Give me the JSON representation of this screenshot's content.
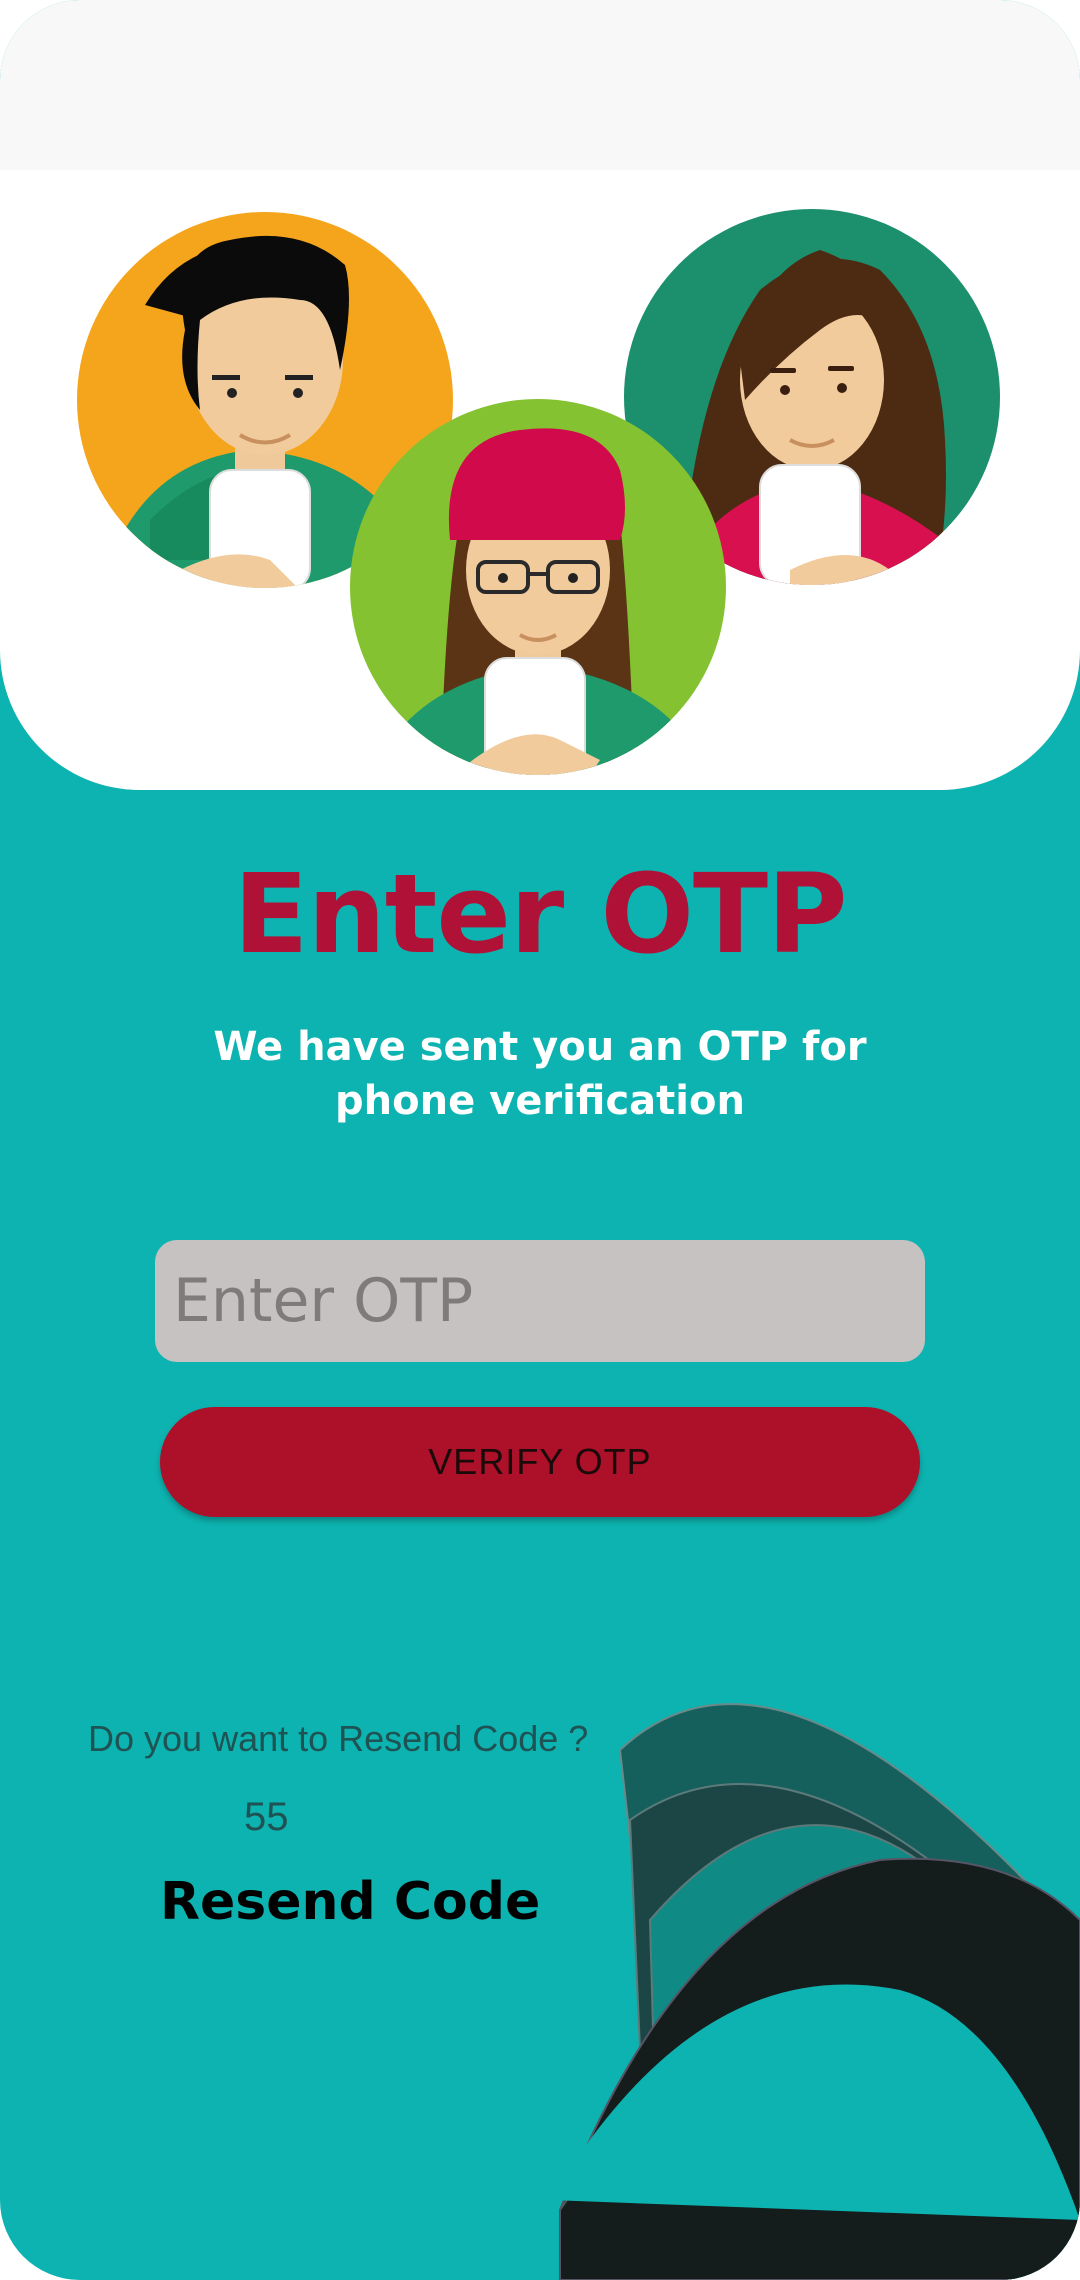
{
  "screen": {
    "title": "Enter OTP",
    "subtitle": "We have sent you an OTP for phone verification"
  },
  "otp_field": {
    "placeholder": "Enter OTP",
    "value": ""
  },
  "verify_button": {
    "label": "VERIFY OTP"
  },
  "resend": {
    "question": "Do you want to Resend Code ?",
    "countdown": "55",
    "link_label": "Resend Code"
  },
  "colors": {
    "background": "#0db3b0",
    "accent": "#b01237",
    "button": "#ad1029",
    "input": "#c7c2c2"
  },
  "illustration": {
    "avatars": [
      "man-with-phone-avatar",
      "girl-with-beanie-phone-avatar",
      "woman-with-phone-avatar"
    ]
  }
}
